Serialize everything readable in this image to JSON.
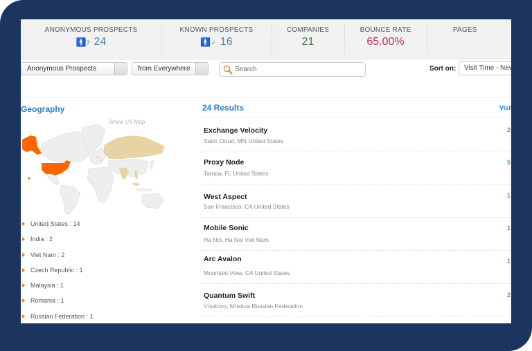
{
  "stats": [
    {
      "label": "ANONYMOUS PROSPECTS",
      "icon": "anonymous-person-icon",
      "icon_glyph": "?",
      "value": "24",
      "color": "#4a86a8"
    },
    {
      "label": "KNOWN PROSPECTS",
      "icon": "known-person-icon",
      "icon_glyph": "✓",
      "value": "16",
      "color": "#4a86a8"
    },
    {
      "label": "COMPANIES",
      "value": "21",
      "color": "#3d7a44"
    },
    {
      "label": "BOUNCE RATE",
      "value": "65.00%",
      "color": "#c0325a"
    },
    {
      "label": "PAGES",
      "value": ""
    }
  ],
  "filters": {
    "prospect_type": "Anonymous Prospects",
    "location": "from Everywhere",
    "search_placeholder": "Search",
    "search_value": "",
    "sort_label": "Sort on:",
    "sort_value": "Visit Time - Newest"
  },
  "geography": {
    "title": "Geography",
    "show_us_map": "Show US Map",
    "map_colors": {
      "high": "#ff6600",
      "low": "#e8d3a4",
      "none": "#eeeeee"
    },
    "countries": [
      {
        "label": "United States : 14"
      },
      {
        "label": "India : 2"
      },
      {
        "label": "Viet Nam : 2"
      },
      {
        "label": "Czech Republic : 1"
      },
      {
        "label": "Malaysia : 1"
      },
      {
        "label": "Romania : 1"
      },
      {
        "label": "Russian Federation : 1"
      }
    ]
  },
  "results": {
    "title": "24 Results",
    "visits_header": "Visits",
    "items": [
      {
        "name": "Exchange Velocity",
        "location": "Saint Cloud, MN United States",
        "visits": "2"
      },
      {
        "name": "Proxy Node",
        "location": "Tampa, FL United States",
        "visits": "5"
      },
      {
        "name": "West Aspect",
        "location": "San Francisco, CA United States",
        "visits": "1"
      },
      {
        "name": "Mobile Sonic",
        "location": "Ha Noi, Ha Noi Viet Nam",
        "visits": "1"
      },
      {
        "name": "Arc Avalon",
        "location": "Mountain View, CA United States",
        "visits": "1"
      },
      {
        "name": "Quantum Swift",
        "location": "Vnukovo, Moskva Russian Federation",
        "visits": "2"
      }
    ]
  }
}
